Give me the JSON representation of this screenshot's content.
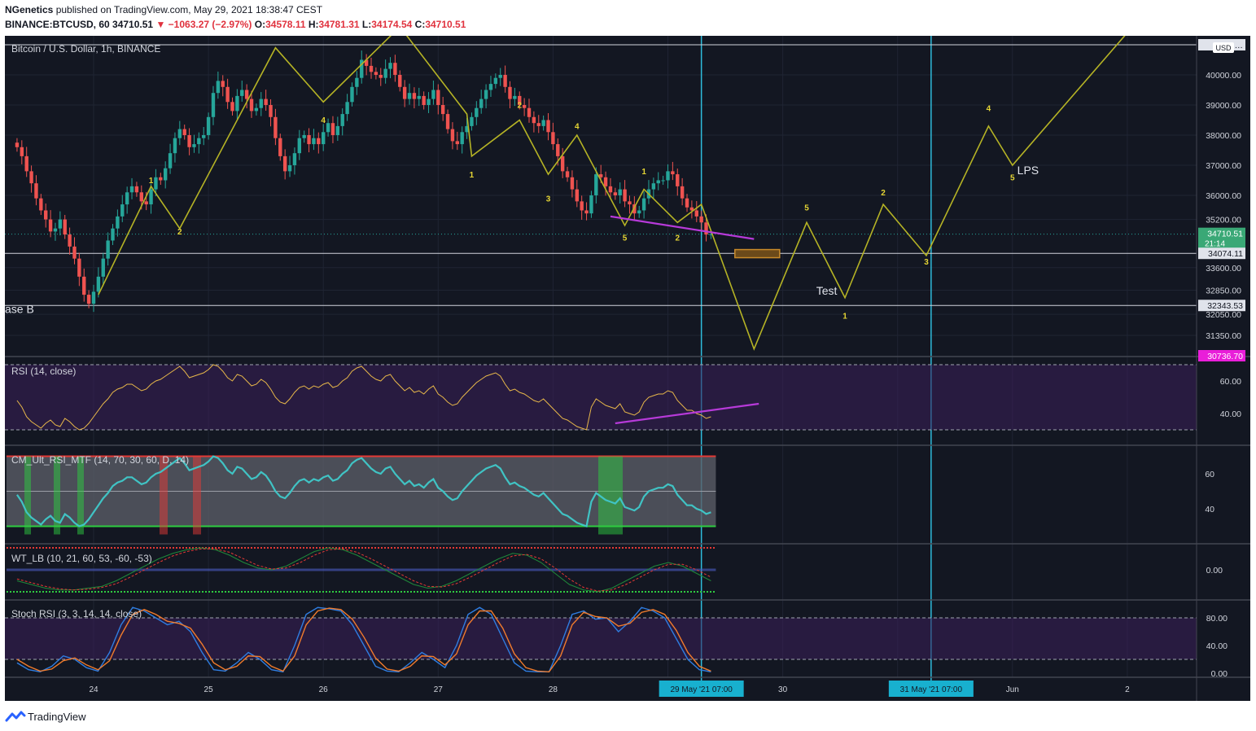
{
  "header": {
    "publisher": "NGenetics",
    "published_text": "published on TradingView.com, May 29, 2021 18:38:47 CEST",
    "symbol": "BINANCE:BTCUSD, 60",
    "last": "34710.51",
    "change": "−1063.27 (−2.97%)",
    "o_label": "O:",
    "o_val": "34578.11",
    "h_label": "H:",
    "h_val": "34781.31",
    "l_label": "L:",
    "l_val": "34174.54",
    "c_label": "C:",
    "c_val": "34710.51"
  },
  "footer": {
    "brand": "TradingView"
  },
  "colors": {
    "bg": "#131722",
    "up": "#26a69a",
    "down": "#ef5350",
    "wave": "#b5b325",
    "trendline": "#b73ad9",
    "vline": "#2ebcdc",
    "rsi": "#e8b84a",
    "ult": "#40c3c4"
  },
  "chart_data": [
    {
      "type": "candlestick",
      "title": "Bitcoin / U.S. Dollar, 1h, BINANCE",
      "currency": "USD",
      "x_ticks": [
        "24",
        "25",
        "26",
        "27",
        "28",
        "29 May '21  07:00",
        "30",
        "31 May '21  07:00",
        "Jun",
        "2"
      ],
      "y_ticks": [
        31350.0,
        32050.0,
        32850.0,
        33600.0,
        35200.0,
        36000.0,
        37000.0,
        38000.0,
        39000.0,
        40000.0
      ],
      "y_tick_labels": [
        "31350.00",
        "32050.00",
        "32850.00",
        "33600.00",
        "35200.00",
        "36000.00",
        "37000.00",
        "38000.00",
        "39000.00",
        "40000.00"
      ],
      "price_labels": [
        {
          "text": "34710.51",
          "sub": "21:14",
          "kind": "last"
        },
        {
          "text": "34074.11",
          "kind": "level"
        },
        {
          "text": "32343.53",
          "kind": "level"
        },
        {
          "text": "41…",
          "kind": "level"
        },
        {
          "text": "30736.70",
          "kind": "marker"
        }
      ],
      "horizontal_levels": [
        41000,
        34074.11,
        32343.53
      ],
      "close_series_hourly": [
        37600,
        37300,
        36800,
        36400,
        35900,
        35500,
        35200,
        34800,
        34900,
        35200,
        34700,
        34300,
        33900,
        33300,
        32700,
        32400,
        32800,
        33300,
        33900,
        34500,
        34900,
        35300,
        35700,
        36100,
        36300,
        36100,
        35800,
        35700,
        36200,
        36600,
        36500,
        36900,
        37400,
        37900,
        38200,
        38000,
        37600,
        37700,
        37900,
        38000,
        38600,
        39400,
        39800,
        39600,
        39100,
        38800,
        39300,
        39500,
        39200,
        38800,
        38900,
        39200,
        39000,
        38600,
        37900,
        37300,
        36800,
        37000,
        37400,
        37900,
        38000,
        37700,
        37900,
        37700,
        38100,
        38400,
        38000,
        38300,
        38700,
        39100,
        39600,
        39900,
        40500,
        40300,
        40100,
        40000,
        39900,
        40200,
        40400,
        40000,
        39600,
        39200,
        39400,
        39200,
        39300,
        39000,
        39200,
        39500,
        39000,
        38700,
        38200,
        37800,
        37700,
        38100,
        38300,
        38600,
        38900,
        39200,
        39500,
        39700,
        39900,
        40000,
        39600,
        39200,
        39300,
        39000,
        38900,
        38600,
        38400,
        38300,
        38500,
        38100,
        37700,
        37300,
        36800,
        36600,
        36200,
        35800,
        35500,
        35400,
        36000,
        36700,
        36600,
        36300,
        36100,
        36000,
        36200,
        35800,
        35700,
        35400,
        35500,
        35900,
        36200,
        36400,
        36500,
        36500,
        36800,
        36700,
        36300,
        35900,
        35600,
        35500,
        35300,
        35100,
        34700,
        34710.51
      ],
      "x_start": "May 23, 08:00",
      "x_interval": "1h",
      "wave_path": [
        {
          "t": "May 24, 01:00",
          "p": 32700
        },
        {
          "t": "May 24, 12:00",
          "p": 36300
        },
        {
          "t": "May 24, 18:00",
          "p": 34900
        },
        {
          "t": "May 25, 14:00",
          "p": 40900
        },
        {
          "t": "May 26, 00:00",
          "p": 39100
        },
        {
          "t": "May 26, 16:00",
          "p": 41600
        },
        {
          "t": "May 27, 06:00",
          "p": 38700
        },
        {
          "t": "May 27, 07:00",
          "p": 37300
        },
        {
          "t": "May 27, 17:00",
          "p": 38500
        },
        {
          "t": "May 27, 23:00",
          "p": 36700
        },
        {
          "t": "May 28, 05:00",
          "p": 38000
        },
        {
          "t": "May 28, 15:00",
          "p": 35000
        },
        {
          "t": "May 28, 19:00",
          "p": 36200
        },
        {
          "t": "May 29, 02:00",
          "p": 35100
        },
        {
          "t": "May 29, 07:00",
          "p": 35700
        },
        {
          "t": "May 29, 18:00",
          "p": 30900
        },
        {
          "t": "May 30, 05:00",
          "p": 35100
        },
        {
          "t": "May 30, 13:00",
          "p": 32600
        },
        {
          "t": "May 30, 21:00",
          "p": 35700
        },
        {
          "t": "May 31, 06:00",
          "p": 34000
        },
        {
          "t": "May 31, 19:00",
          "p": 38300
        },
        {
          "t": "Jun 1, 00:00",
          "p": 37000
        },
        {
          "t": "Jun 2, 00:00",
          "p": 41400
        }
      ],
      "annotations": [
        {
          "text": "3"
        },
        {
          "text": "1"
        },
        {
          "text": "2"
        },
        {
          "text": "4"
        },
        {
          "text": "1"
        },
        {
          "text": "2"
        },
        {
          "text": "3"
        },
        {
          "text": "4"
        },
        {
          "text": "1"
        },
        {
          "text": "5"
        },
        {
          "text": "2"
        },
        {
          "text": "5"
        },
        {
          "text": "2"
        },
        {
          "text": "3"
        },
        {
          "text": "1"
        },
        {
          "text": "4"
        },
        {
          "text": "5"
        },
        {
          "text": "Test"
        },
        {
          "text": "LPS"
        },
        {
          "text": "ase B"
        }
      ]
    },
    {
      "type": "line",
      "title": "RSI (14, close)",
      "y_ticks": [
        40.0,
        60.0
      ],
      "y_tick_labels": [
        "40.00",
        "60.00"
      ],
      "band": [
        30,
        70
      ],
      "values": [
        48,
        44,
        38,
        35,
        33,
        31,
        34,
        36,
        33,
        32,
        37,
        35,
        32,
        30,
        31,
        34,
        38,
        42,
        46,
        49,
        53,
        55,
        56,
        58,
        58,
        56,
        54,
        55,
        58,
        60,
        61,
        63,
        65,
        67,
        69,
        66,
        62,
        63,
        64,
        65,
        67,
        70,
        69,
        66,
        62,
        60,
        64,
        63,
        60,
        57,
        58,
        61,
        59,
        55,
        50,
        47,
        46,
        49,
        53,
        56,
        57,
        55,
        57,
        56,
        58,
        59,
        56,
        57,
        60,
        62,
        66,
        68,
        69,
        66,
        63,
        61,
        60,
        63,
        64,
        60,
        57,
        54,
        56,
        53,
        54,
        52,
        55,
        57,
        52,
        50,
        47,
        45,
        46,
        50,
        53,
        56,
        59,
        61,
        63,
        64,
        65,
        63,
        58,
        54,
        55,
        53,
        52,
        50,
        48,
        47,
        49,
        46,
        43,
        40,
        37,
        36,
        34,
        32,
        31,
        30,
        44,
        49,
        47,
        45,
        44,
        43,
        46,
        41,
        40,
        39,
        41,
        47,
        50,
        51,
        52,
        52,
        54,
        53,
        48,
        45,
        42,
        42,
        40,
        39,
        37,
        38
      ],
      "trendline": "rising"
    },
    {
      "type": "line",
      "title": "CM_Ult_RSI_MTF (14, 70, 30, 60, D, 14)",
      "y_ticks": [
        40,
        60
      ],
      "y_tick_labels": [
        "40",
        "60"
      ],
      "band": [
        30,
        70
      ],
      "midline": 50,
      "values": [
        48,
        44,
        38,
        35,
        33,
        31,
        34,
        36,
        33,
        32,
        37,
        35,
        32,
        30,
        31,
        34,
        38,
        42,
        46,
        49,
        53,
        55,
        56,
        58,
        58,
        56,
        54,
        55,
        58,
        60,
        61,
        63,
        65,
        67,
        69,
        66,
        62,
        63,
        64,
        65,
        67,
        70,
        69,
        66,
        62,
        60,
        64,
        63,
        60,
        57,
        58,
        61,
        59,
        55,
        50,
        47,
        46,
        49,
        53,
        56,
        57,
        55,
        57,
        56,
        58,
        59,
        56,
        57,
        60,
        62,
        66,
        68,
        69,
        66,
        63,
        61,
        60,
        63,
        64,
        60,
        57,
        54,
        56,
        53,
        54,
        52,
        55,
        57,
        52,
        50,
        47,
        45,
        46,
        50,
        53,
        56,
        59,
        61,
        63,
        64,
        65,
        63,
        58,
        54,
        55,
        53,
        52,
        50,
        48,
        47,
        49,
        46,
        43,
        40,
        37,
        36,
        34,
        32,
        31,
        30,
        44,
        49,
        47,
        45,
        44,
        43,
        46,
        41,
        40,
        39,
        41,
        47,
        50,
        51,
        52,
        52,
        54,
        53,
        48,
        45,
        42,
        42,
        40,
        39,
        37,
        38
      ]
    },
    {
      "type": "line",
      "title": "WT_LB (10, 21, 60, 53, -60, -53)",
      "y_ticks": [
        0.0
      ],
      "y_tick_labels": [
        "0.00"
      ],
      "series": [
        {
          "values": [
            -30,
            -40,
            -50,
            -55,
            -55,
            -50,
            -45,
            -30,
            -10,
            10,
            30,
            45,
            55,
            60,
            55,
            40,
            20,
            5,
            0,
            10,
            30,
            50,
            60,
            55,
            40,
            20,
            0,
            -20,
            -40,
            -50,
            -45,
            -30,
            -10,
            10,
            30,
            45,
            40,
            20,
            -10,
            -40,
            -55,
            -60,
            -50,
            -30,
            -10,
            10,
            20,
            10,
            -10,
            -30
          ]
        },
        {
          "values": [
            -25,
            -35,
            -45,
            -52,
            -55,
            -53,
            -48,
            -38,
            -20,
            0,
            20,
            38,
            50,
            57,
            57,
            48,
            30,
            12,
            2,
            5,
            20,
            40,
            55,
            57,
            48,
            30,
            10,
            -10,
            -30,
            -45,
            -47,
            -38,
            -20,
            0,
            20,
            38,
            42,
            30,
            5,
            -25,
            -48,
            -58,
            -55,
            -40,
            -20,
            0,
            15,
            15,
            0,
            -20
          ]
        }
      ]
    },
    {
      "type": "line",
      "title": "Stoch RSI (3, 3, 14, 14, close)",
      "y_ticks": [
        0.0,
        40.0,
        80.0
      ],
      "y_tick_labels": [
        "0.00",
        "40.00",
        "80.00"
      ],
      "band": [
        20,
        80
      ],
      "series": [
        {
          "values": [
            15,
            5,
            2,
            10,
            25,
            20,
            8,
            3,
            30,
            70,
            95,
            90,
            80,
            70,
            75,
            60,
            30,
            5,
            3,
            15,
            30,
            20,
            5,
            2,
            40,
            85,
            95,
            93,
            90,
            70,
            40,
            10,
            3,
            2,
            15,
            30,
            20,
            8,
            40,
            85,
            95,
            85,
            50,
            15,
            3,
            2,
            2,
            40,
            85,
            90,
            78,
            80,
            60,
            75,
            95,
            90,
            80,
            50,
            20,
            5,
            2
          ]
        },
        {
          "values": [
            20,
            10,
            3,
            6,
            18,
            22,
            12,
            5,
            18,
            55,
            85,
            92,
            85,
            75,
            72,
            65,
            42,
            15,
            5,
            10,
            25,
            24,
            10,
            3,
            25,
            70,
            90,
            94,
            92,
            78,
            52,
            22,
            6,
            3,
            10,
            25,
            24,
            12,
            28,
            70,
            90,
            90,
            65,
            28,
            8,
            3,
            2,
            25,
            70,
            88,
            82,
            80,
            68,
            72,
            88,
            92,
            85,
            62,
            30,
            10,
            3
          ]
        }
      ]
    }
  ]
}
